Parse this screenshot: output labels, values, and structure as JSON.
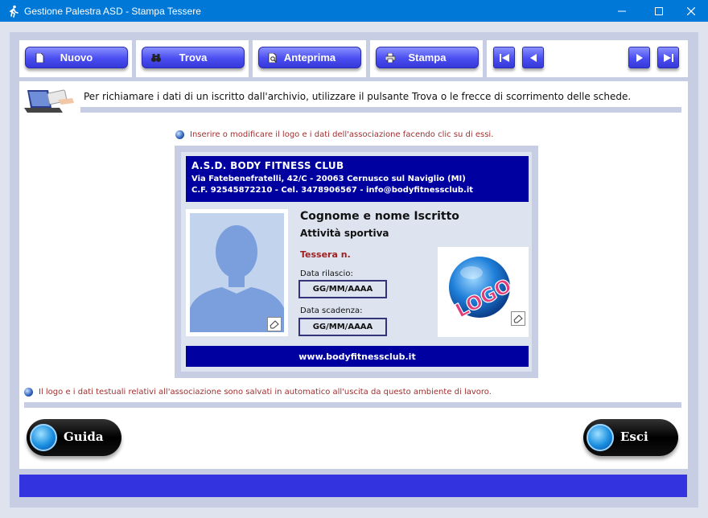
{
  "window": {
    "title": "Gestione Palestra ASD - Stampa Tessere",
    "icons": {
      "app": "runner-icon",
      "minimize": "minimize-icon",
      "maximize": "maximize-icon",
      "close": "close-icon"
    }
  },
  "toolbar": {
    "new_label": "Nuovo",
    "find_label": "Trova",
    "preview_label": "Anteprima",
    "print_label": "Stampa",
    "icons": {
      "new": "document-icon",
      "find": "binoculars-icon",
      "preview": "preview-icon",
      "print": "printer-icon",
      "first": "first-record-icon",
      "prev": "previous-record-icon",
      "next": "next-record-icon",
      "last": "last-record-icon"
    }
  },
  "info": {
    "text": "Per richiamare i dati di un iscritto dall'archivio, utilizzare il pulsante Trova o le frecce di scorrimento delle schede."
  },
  "hint_top": "Inserire o modificare il logo e i dati dell'associazione facendo clic su di essi.",
  "card": {
    "org_name": "A.S.D. BODY FITNESS CLUB",
    "address": "Via Fatebenefratelli, 42/C - 20063 Cernusco sul Naviglio (MI)",
    "tax_contacts": "C.F. 92545872210 - Cel. 3478906567 - info@bodyfitnessclub.it",
    "member_name": "Cognome e nome Iscritto",
    "activity": "Attività sportiva",
    "card_number_label": "Tessera n.",
    "issue_date_label": "Data rilascio:",
    "issue_date_value": "GG/MM/AAAA",
    "expiry_date_label": "Data scadenza:",
    "expiry_date_value": "GG/MM/AAAA",
    "logo_text": "LOGO",
    "website": "www.bodyfitnessclub.it"
  },
  "hint_bottom": "Il logo e i dati testuali relativi all'associazione sono salvati in automatico all'uscita da questo ambiente di lavoro.",
  "buttons": {
    "help_label": "Guida",
    "exit_label": "Esci"
  },
  "colors": {
    "accent_blue": "#0000a0",
    "toolbar_button": "#4a4df0",
    "titlebar": "#0078d7",
    "hint_red": "#a03030",
    "status_bar": "#3333e0"
  }
}
